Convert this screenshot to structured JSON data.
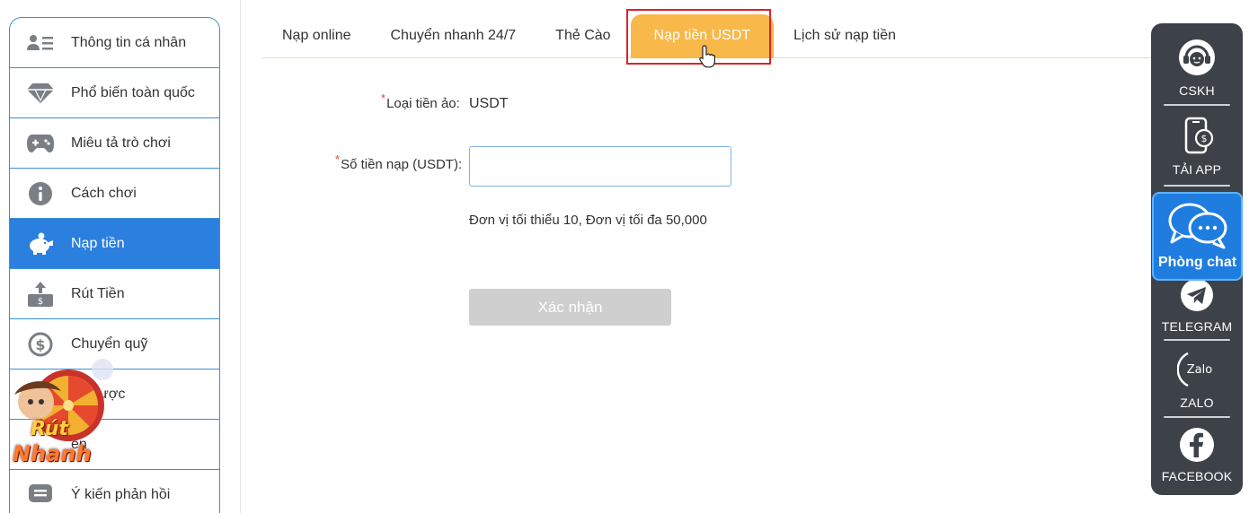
{
  "sidebar": {
    "items": [
      {
        "label": "Thông tin cá nhân",
        "icon": "user-card-icon"
      },
      {
        "label": "Phổ biến toàn quốc",
        "icon": "diamond-icon"
      },
      {
        "label": "Miêu tả trò chơi",
        "icon": "gamepad-icon"
      },
      {
        "label": "Cách chơi",
        "icon": "info-icon"
      },
      {
        "label": "Nạp tiền",
        "icon": "piggy-bank-icon",
        "active": true
      },
      {
        "label": "Rút Tiền",
        "icon": "withdraw-icon"
      },
      {
        "label": "Chuyển quỹ",
        "icon": "dollar-circle-icon"
      },
      {
        "label": "sử cược",
        "icon": "history-icon"
      },
      {
        "label": "ền",
        "icon": "wallet-icon"
      },
      {
        "label": "Ý kiến phản hồi",
        "icon": "feedback-icon"
      }
    ]
  },
  "promo": {
    "line1": "Rút",
    "line2": "Nhanh"
  },
  "tabs": [
    {
      "label": "Nạp online"
    },
    {
      "label": "Chuyển nhanh 24/7"
    },
    {
      "label": "Thẻ Cào"
    },
    {
      "label": "Nạp tiền USDT",
      "active": true
    },
    {
      "label": "Lịch sử nạp tiền"
    }
  ],
  "form": {
    "currency_label": "Loại tiền ảo:",
    "currency_value": "USDT",
    "amount_label": "Số tiền nạp (USDT):",
    "amount_value": "",
    "amount_placeholder": "",
    "required_mark": "*",
    "hint": "Đơn vị tối thiểu 10, Đơn vị tối đa 50,000",
    "submit_label": "Xác nhận"
  },
  "contact": {
    "items": [
      {
        "label": "CSKH",
        "icon": "support-agent-icon"
      },
      {
        "label": "TẢI APP",
        "icon": "phone-download-icon"
      },
      {
        "label": "TELEGRAM",
        "icon": "telegram-icon"
      },
      {
        "label": "ZALO",
        "icon": "zalo-icon",
        "glyph": "Zalo"
      },
      {
        "label": "FACEBOOK",
        "icon": "facebook-icon"
      }
    ],
    "chat": {
      "label": "Phòng chat",
      "icon": "chat-bubbles-icon"
    }
  },
  "colors": {
    "accent_blue": "#2b7fdf",
    "tab_active": "#f8b84a",
    "highlight_red": "#d9242b",
    "panel_dark": "#3d4248",
    "button_disabled": "#cfcfcf"
  }
}
